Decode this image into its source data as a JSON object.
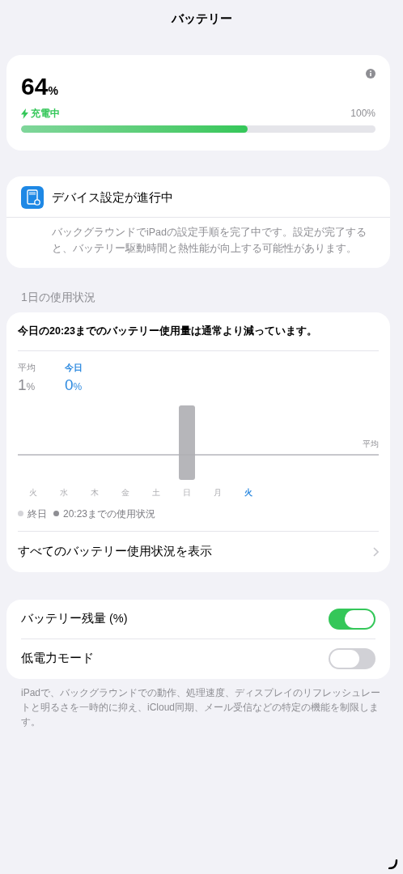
{
  "title": "バッテリー",
  "battery": {
    "percent": "64",
    "unit": "%",
    "status": "充電中",
    "charging": true,
    "max_label": "100%",
    "level": 0.64
  },
  "setup": {
    "title": "デバイス設定が進行中",
    "body": "バックグラウンドでiPadの設定手順を完了中です。設定が完了すると、バッテリー駆動時間と熱性能が向上する可能性があります。"
  },
  "usage": {
    "header": "1日の使用状況",
    "summary": "今日の20:23までのバッテリー使用量は通常より減っています。",
    "stats": [
      {
        "label": "平均",
        "value": "1",
        "unit": "%",
        "selected": false
      },
      {
        "label": "今日",
        "value": "0",
        "unit": "%",
        "selected": true
      }
    ],
    "average_label": "平均",
    "days": [
      {
        "label": "火",
        "selected": false,
        "bar": false
      },
      {
        "label": "水",
        "selected": false,
        "bar": false
      },
      {
        "label": "木",
        "selected": false,
        "bar": false
      },
      {
        "label": "金",
        "selected": false,
        "bar": false
      },
      {
        "label": "土",
        "selected": false,
        "bar": false
      },
      {
        "label": "日",
        "selected": false,
        "bar": true
      },
      {
        "label": "月",
        "selected": false,
        "bar": false
      },
      {
        "label": "火",
        "selected": true,
        "bar": false
      }
    ],
    "legend": [
      {
        "label": "終日",
        "color": "#d4d4d8"
      },
      {
        "label": "20:23までの使用状況",
        "color": "#8e8e93"
      }
    ],
    "link": "すべてのバッテリー使用状況を表示"
  },
  "toggles": [
    {
      "label": "バッテリー残量 (%)",
      "on": true
    },
    {
      "label": "低電力モード",
      "on": false
    }
  ],
  "footnote": "iPadで、バックグラウンドでの動作、処理速度、ディスプレイのリフレッシュレートと明るさを一時的に抑え、iCloud同期、メール受信などの特定の機能を制限します。"
}
